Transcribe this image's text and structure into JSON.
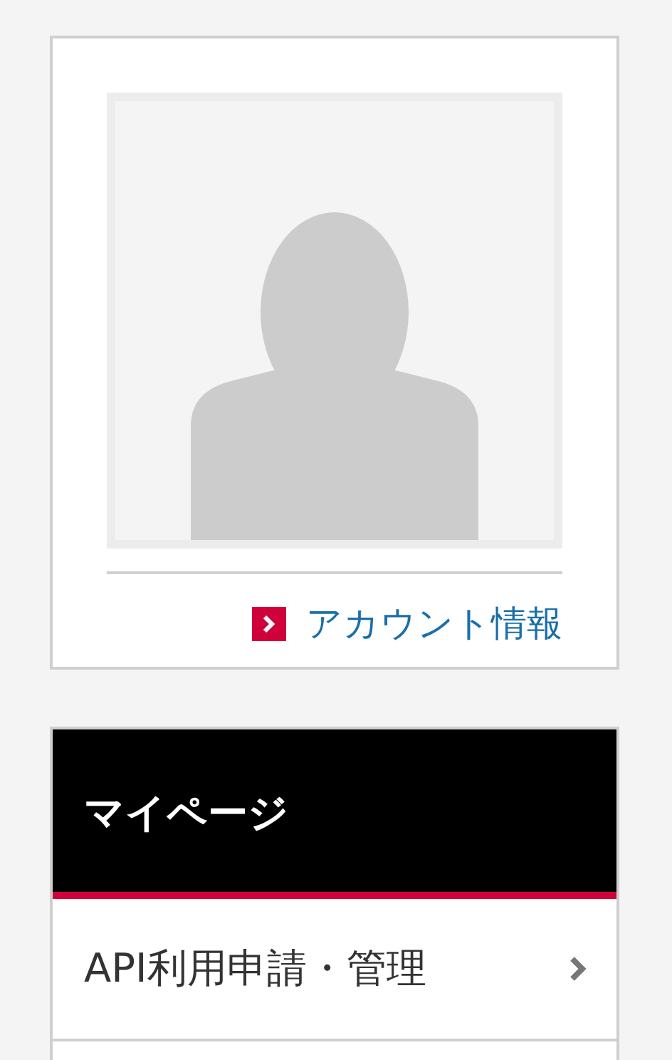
{
  "profile": {
    "avatar": {
      "kind": "placeholder"
    },
    "account_link": "アカウント情報"
  },
  "mypage": {
    "title": "マイページ",
    "items": [
      {
        "label": "API利用申請・管理"
      }
    ]
  }
}
